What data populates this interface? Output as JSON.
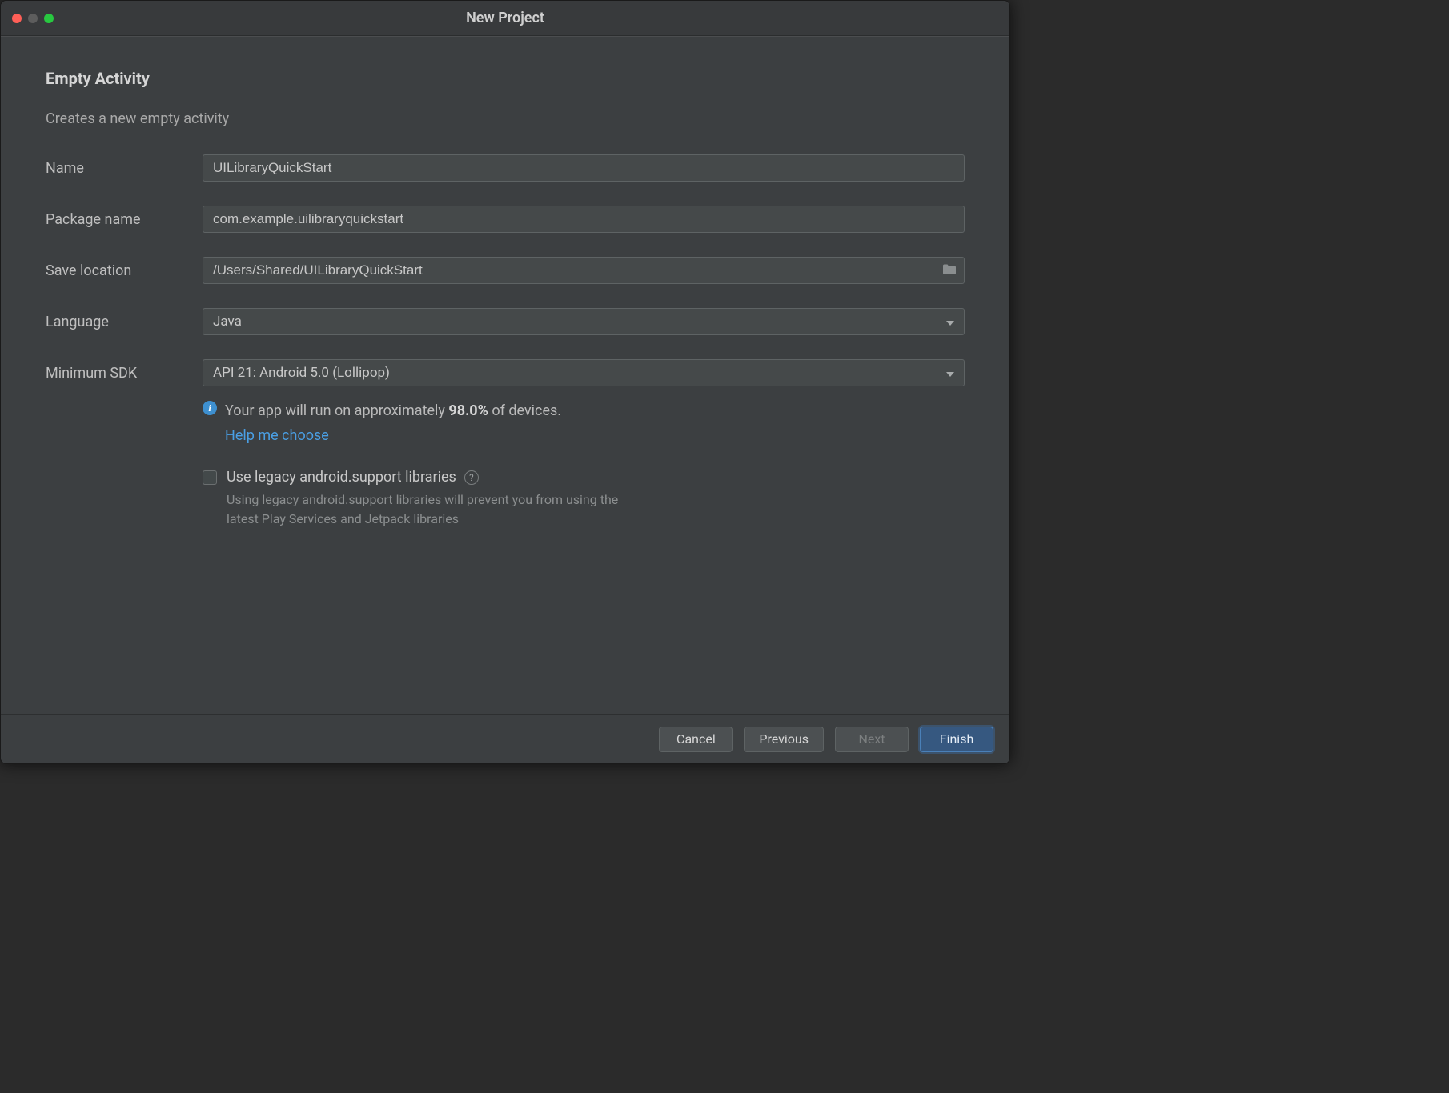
{
  "window": {
    "title": "New Project"
  },
  "page": {
    "heading": "Empty Activity",
    "subheading": "Creates a new empty activity"
  },
  "form": {
    "name_label": "Name",
    "name_value": "UILibraryQuickStart",
    "package_label": "Package name",
    "package_value": "com.example.uilibraryquickstart",
    "location_label": "Save location",
    "location_value": "/Users/Shared/UILibraryQuickStart",
    "language_label": "Language",
    "language_value": "Java",
    "sdk_label": "Minimum SDK",
    "sdk_value": "API 21: Android 5.0 (Lollipop)"
  },
  "info": {
    "prefix": "Your app will run on approximately ",
    "percent": "98.0%",
    "suffix": " of devices.",
    "help_link": "Help me choose"
  },
  "legacy": {
    "label": "Use legacy android.support libraries",
    "hint": "Using legacy android.support libraries will prevent you from using the latest Play Services and Jetpack libraries"
  },
  "buttons": {
    "cancel": "Cancel",
    "previous": "Previous",
    "next": "Next",
    "finish": "Finish"
  }
}
